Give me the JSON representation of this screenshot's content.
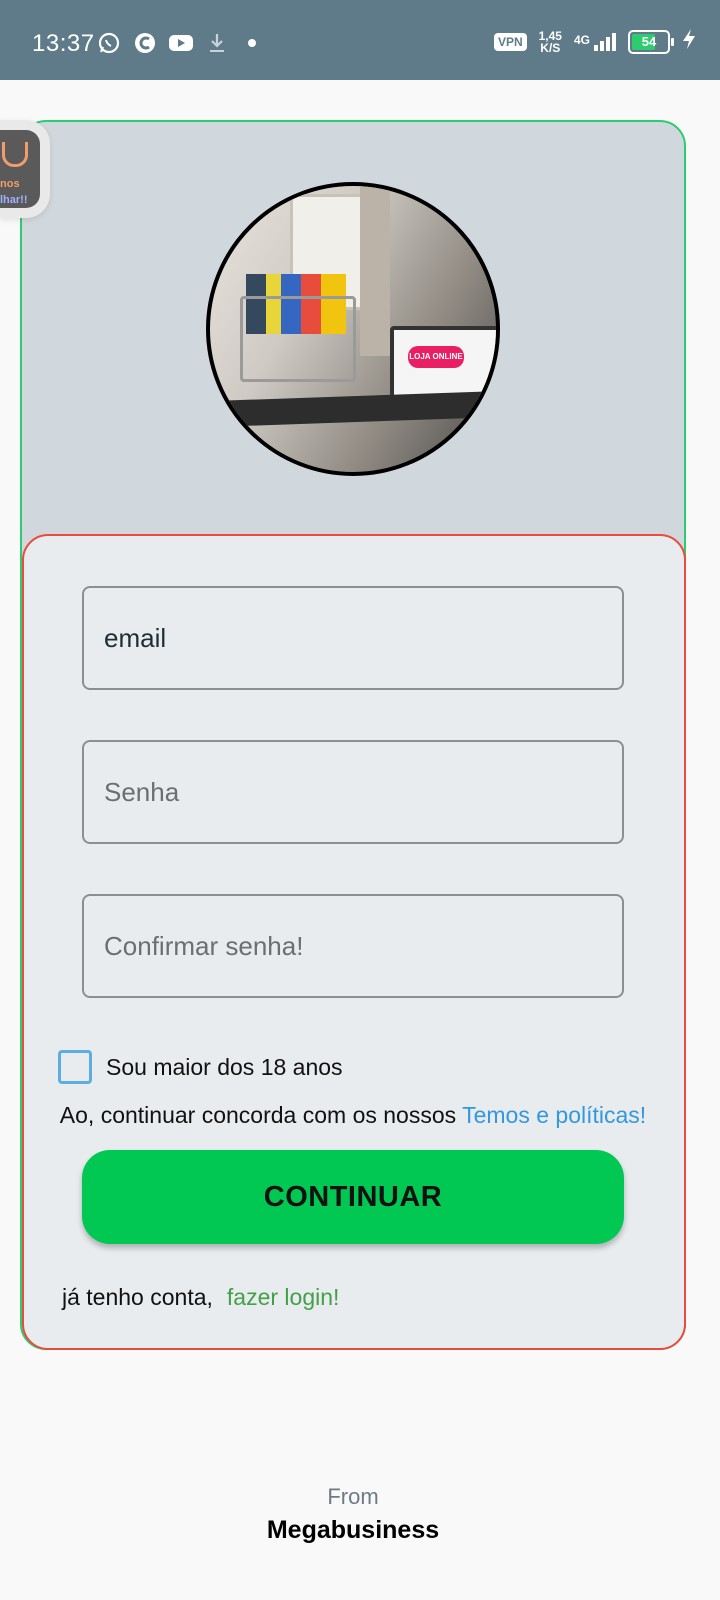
{
  "status_bar": {
    "time": "13:37",
    "vpn": "VPN",
    "speed_value": "1,45",
    "speed_unit": "K/S",
    "network": "4G",
    "battery": "54",
    "icons_left": [
      "whatsapp-icon",
      "c-app-icon",
      "youtube-icon",
      "download-icon",
      "dot-icon"
    ]
  },
  "bubble": {
    "line1": "nos",
    "line2": "lhar!!"
  },
  "hero": {
    "laptop_banner": "LOJA ONLINE"
  },
  "form": {
    "email": {
      "value": "email",
      "placeholder": "email"
    },
    "password": {
      "placeholder": "Senha"
    },
    "confirm_password": {
      "placeholder": "Confirmar senha!"
    },
    "age_checkbox_label": "Sou maior dos 18 anos",
    "age_checked": false,
    "terms_text": "Ao, continuar concorda com os nossos ",
    "terms_link": "Temos e políticas!",
    "continue_label": "CONTINUAR",
    "login_text": "já tenho conta,",
    "login_link": "fazer login!"
  },
  "footer": {
    "from": "From",
    "brand": "Megabusiness"
  },
  "colors": {
    "status_bar": "#5f7b8a",
    "outer_border": "#2ecc71",
    "form_border": "#e74c3c",
    "button": "#00c853",
    "terms_link": "#3498db",
    "login_link": "#43a047"
  }
}
